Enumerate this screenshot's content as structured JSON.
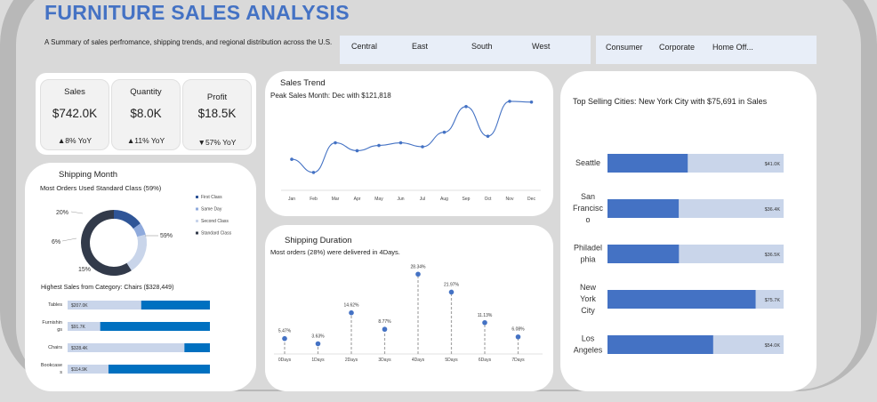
{
  "header": {
    "title": "FURNITURE SALES ANALYSIS",
    "subtitle": "A Summary of sales perfromance, shipping trends, and regional distribution across the U.S."
  },
  "region_slicer": [
    "Central",
    "East",
    "South",
    "West"
  ],
  "segment_slicer": [
    "Consumer",
    "Corporate",
    "Home Off..."
  ],
  "kpis": [
    {
      "label": "Sales",
      "value": "$742.0K",
      "yoy": "▲8% YoY"
    },
    {
      "label": "Quantity",
      "value": "$8.0K",
      "yoy": "▲11% YoY"
    },
    {
      "label": "Profit",
      "value": "$18.5K",
      "yoy": "▼57% YoY"
    }
  ],
  "shipping": {
    "title": "Shipping Month",
    "subtitle": "Most Orders Used Standard Class (59%)",
    "donut_labels": [
      "20%",
      "6%",
      "59%",
      "15%"
    ],
    "category_title": "Highest Sales from Category: Chairs ($328,449)"
  },
  "trend": {
    "title": "Sales Trend",
    "subtitle": "Peak Sales Month: Dec with $121,818"
  },
  "duration": {
    "title": "Shipping Duration",
    "subtitle": "Most orders (28%) were delivered in 4Days."
  },
  "cities": {
    "title": "Top Selling Cities: New York City with $75,691 in Sales"
  },
  "chart_data": [
    {
      "type": "pie",
      "name": "Ship mode share",
      "categories": [
        "First Class",
        "Same Day",
        "Second Class",
        "Standard Class"
      ],
      "values": [
        15,
        6,
        20,
        59
      ],
      "colors": [
        "#2f5597",
        "#8faadc",
        "#c9d5ea",
        "#323a4a"
      ],
      "legend_position": "right"
    },
    {
      "type": "bar",
      "orientation": "horizontal",
      "categories": [
        "Tables",
        "Furnishings",
        "Chairs",
        "Bookcases"
      ],
      "category_labels": [
        "Tables",
        "Furnishin\ngs",
        "Chairs",
        "Bookcase\ns"
      ],
      "values": [
        207.0,
        91.7,
        328.4,
        114.9
      ],
      "labels": [
        "$207.0K",
        "$91.7K",
        "$328.4K",
        "$114.9K"
      ],
      "xlim": [
        0,
        400
      ]
    },
    {
      "type": "line",
      "x": [
        "Jan",
        "Feb",
        "Mar",
        "Apr",
        "May",
        "Jun",
        "Jul",
        "Aug",
        "Sep",
        "Oct",
        "Nov",
        "Dec"
      ],
      "values": [
        35,
        15,
        60,
        48,
        56,
        60,
        54,
        76,
        115,
        70,
        123,
        121.8
      ],
      "ylim": [
        0,
        135
      ]
    },
    {
      "type": "scatter",
      "style": "lollipop",
      "x": [
        "0Days",
        "1Days",
        "2Days",
        "3Days",
        "4Days",
        "5Days",
        "6Days",
        "7Days"
      ],
      "values": [
        5.47,
        3.63,
        14.62,
        8.77,
        28.34,
        21.97,
        11.13,
        6.08
      ],
      "labels": [
        "5.47%",
        "3.63%",
        "14.62%",
        "8.77%",
        "28.34%",
        "21.97%",
        "11.13%",
        "6.08%"
      ],
      "ylim": [
        0,
        30
      ]
    },
    {
      "type": "bar",
      "orientation": "horizontal",
      "categories": [
        "Seattle",
        "San Francisco",
        "Philadelphia",
        "New York City",
        "Los Angeles"
      ],
      "category_labels": [
        "Seattle",
        "San\nFrancisc\no",
        "Philadel\nphia",
        "New\nYork\nCity",
        "Los\nAngeles"
      ],
      "values": [
        41.0,
        36.4,
        36.5,
        75.7,
        54.0
      ],
      "labels": [
        "$41.0K",
        "$36.4K",
        "$36.5K",
        "$75.7K",
        "$54.0K"
      ],
      "xlim": [
        0,
        90
      ]
    }
  ],
  "colors": {
    "accent": "#4472c4",
    "dark_blue": "#0070c0",
    "light_blue": "#c9d5ea",
    "navy": "#323a4a"
  }
}
